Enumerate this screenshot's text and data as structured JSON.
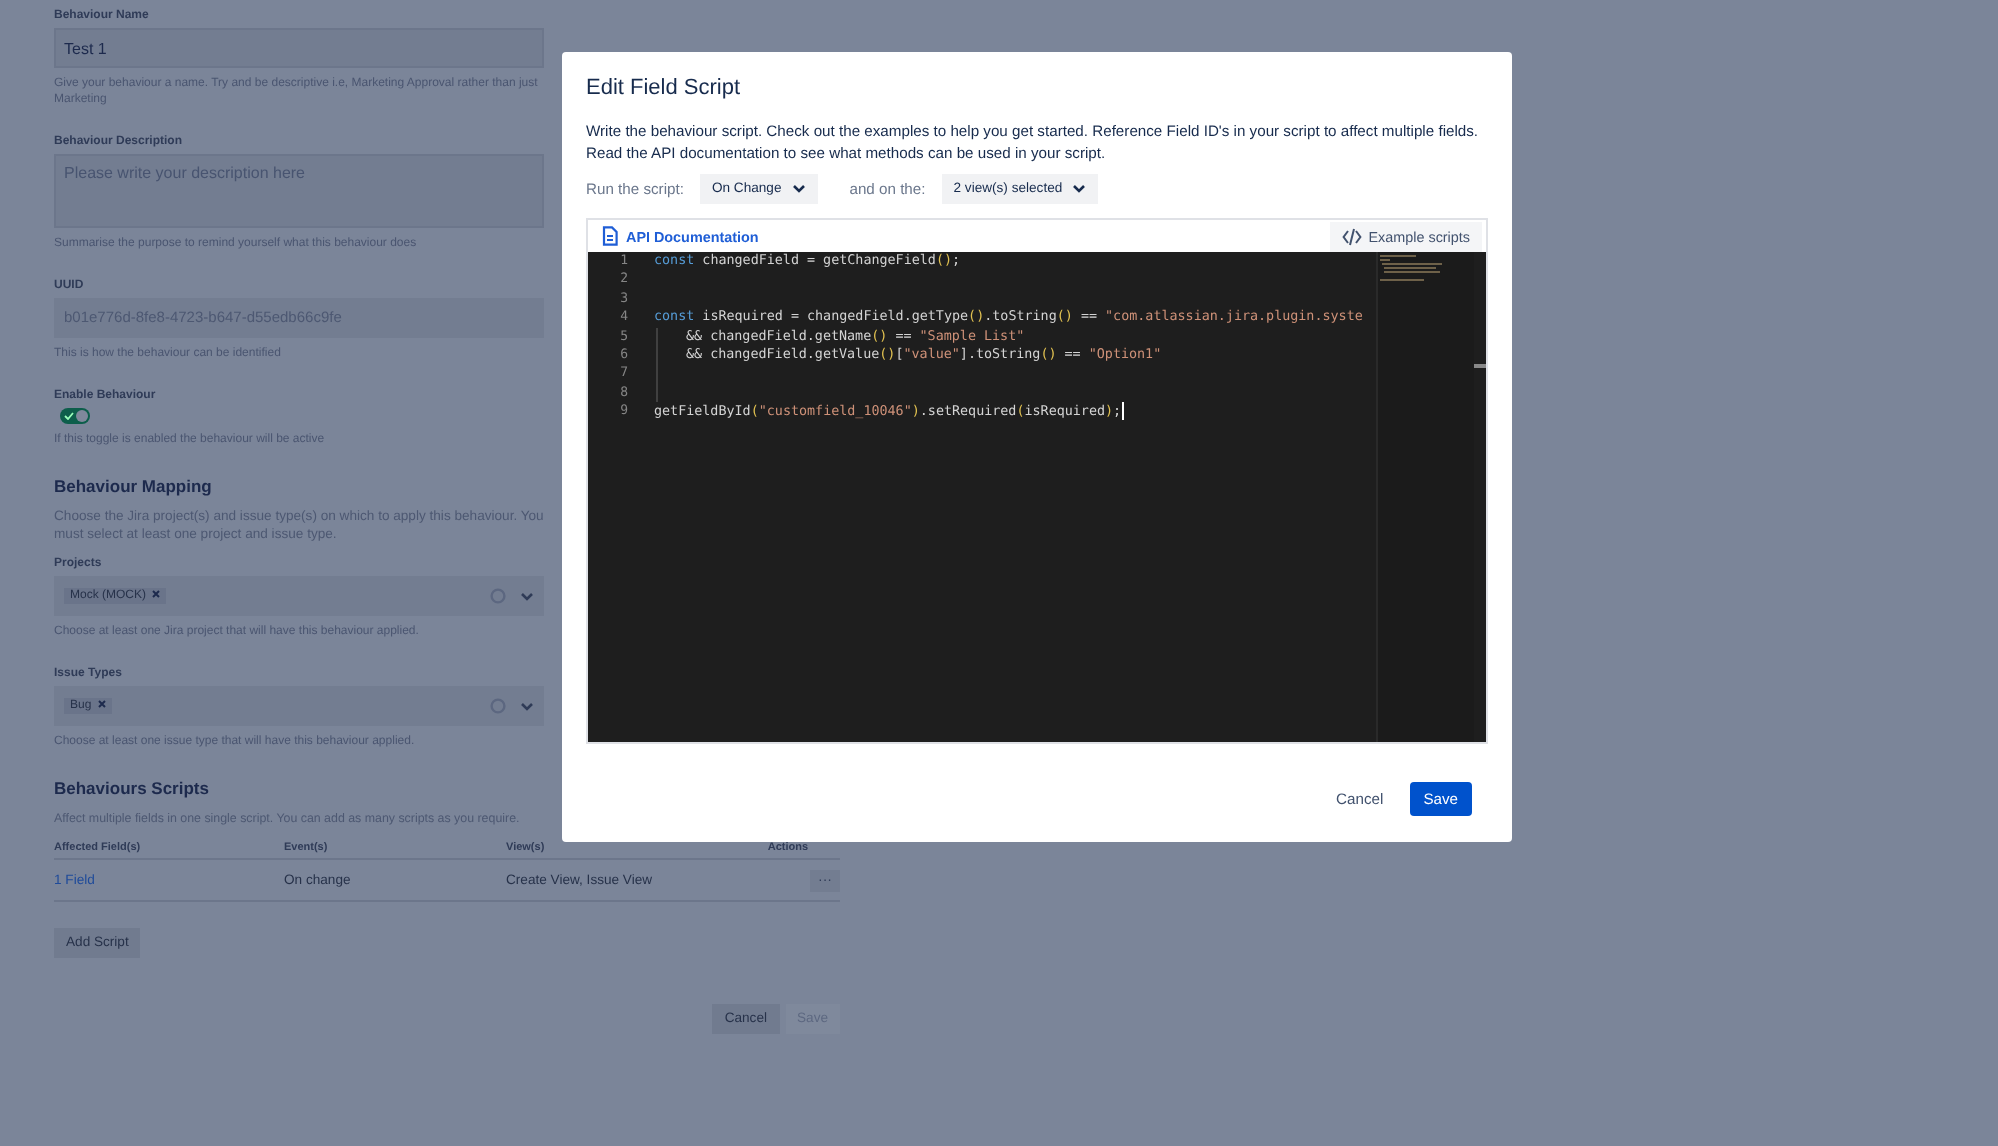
{
  "form": {
    "fields": [
      {
        "kind": "text",
        "label": "Behaviour Name",
        "value": "Test 1",
        "hint": "Give your behaviour a name. Try and be descriptive i.e, Marketing Approval rather than just Marketing"
      },
      {
        "kind": "textarea",
        "label": "Behaviour Description",
        "placeholder": "Please write your description here",
        "hint": "Summarise the purpose to remind yourself what this behaviour does"
      },
      {
        "kind": "readonly",
        "label": "UUID",
        "value": "b01e776d-8fe8-4723-b647-d55edb66c9fe",
        "hint": "This is how the behaviour can be identified"
      },
      {
        "kind": "toggle",
        "label": "Enable Behaviour",
        "on": true,
        "hint": "If this toggle is enabled the behaviour will be active"
      }
    ],
    "mapping": {
      "heading": "Behaviour Mapping",
      "description": "Choose the Jira project(s) and issue type(s) on which to apply this behaviour. You must select at least one project and issue type.",
      "selects": [
        {
          "label": "Projects",
          "tags": [
            "Mock (MOCK)"
          ],
          "hint": "Choose at least one Jira project that will have this behaviour applied."
        },
        {
          "label": "Issue Types",
          "tags": [
            "Bug"
          ],
          "hint": "Choose at least one issue type that will have this behaviour applied."
        }
      ]
    },
    "scripts": {
      "heading": "Behaviours Scripts",
      "description": "Affect multiple fields in one single script. You can add as many scripts as you require.",
      "table": {
        "columns": [
          "Affected Field(s)",
          "Event(s)",
          "View(s)",
          "Actions"
        ],
        "rows": [
          {
            "fields": "1 Field",
            "events": "On change",
            "views": "Create View, Issue View",
            "actions": "···"
          }
        ]
      },
      "add_button": "Add Script"
    },
    "buttons": [
      {
        "label": "Cancel",
        "disabled": false
      },
      {
        "label": "Save",
        "disabled": true
      }
    ]
  },
  "dialog": {
    "title": "Edit Field Script",
    "description": "Write the behaviour script. Check out the examples to help you get started. Reference Field ID's in your script to affect multiple fields. Read the API documentation to see what methods can be used in your script.",
    "run_label": "Run the script:",
    "run_value": "On Change",
    "on_label": "and on the:",
    "on_value": "2 view(s) selected",
    "api_link": "API Documentation",
    "examples_button": "Example scripts",
    "code": [
      {
        "number": "1",
        "tokens": [
          {
            "kind": "keyword",
            "text": "const"
          },
          {
            "kind": "plain",
            "text": " changedField = getChangeField"
          },
          {
            "kind": "paren",
            "text": "()"
          },
          {
            "kind": "plain",
            "text": ";"
          }
        ]
      },
      {
        "number": "2"
      },
      {
        "number": "3"
      },
      {
        "number": "4",
        "tokens": [
          {
            "kind": "keyword",
            "text": "const"
          },
          {
            "kind": "plain",
            "text": " isRequired = changedField.getType"
          },
          {
            "kind": "paren",
            "text": "()"
          },
          {
            "kind": "plain",
            "text": ".toString"
          },
          {
            "kind": "paren",
            "text": "()"
          },
          {
            "kind": "plain",
            "text": " == "
          },
          {
            "kind": "string",
            "text": "\"com.atlassian.jira.plugin.syste"
          }
        ]
      },
      {
        "number": "5",
        "indent": true,
        "tokens": [
          {
            "kind": "plain",
            "text": "&& changedField.getName"
          },
          {
            "kind": "paren",
            "text": "()"
          },
          {
            "kind": "plain",
            "text": " == "
          },
          {
            "kind": "string",
            "text": "\"Sample List\""
          }
        ]
      },
      {
        "number": "6",
        "indent": true,
        "tokens": [
          {
            "kind": "plain",
            "text": "&& changedField.getValue"
          },
          {
            "kind": "paren",
            "text": "()"
          },
          {
            "kind": "plain",
            "text": "["
          },
          {
            "kind": "string",
            "text": "\"value\""
          },
          {
            "kind": "plain",
            "text": "].toString"
          },
          {
            "kind": "paren",
            "text": "()"
          },
          {
            "kind": "plain",
            "text": " == "
          },
          {
            "kind": "string",
            "text": "\"Option1\""
          }
        ]
      },
      {
        "number": "7",
        "indent": true
      },
      {
        "number": "8",
        "indent": true
      },
      {
        "number": "9",
        "cursor": true,
        "tokens": [
          {
            "kind": "plain",
            "text": "getFieldById"
          },
          {
            "kind": "paren",
            "text": "("
          },
          {
            "kind": "string",
            "text": "\"customfield_10046\""
          },
          {
            "kind": "paren",
            "text": ")"
          },
          {
            "kind": "plain",
            "text": ".setRequired"
          },
          {
            "kind": "paren",
            "text": "("
          },
          {
            "kind": "plain",
            "text": "isRequired"
          },
          {
            "kind": "paren",
            "text": ")"
          },
          {
            "kind": "plain",
            "text": ";"
          }
        ]
      }
    ],
    "buttons": [
      {
        "label": "Cancel",
        "primary": false
      },
      {
        "label": "Save",
        "primary": true
      }
    ]
  }
}
